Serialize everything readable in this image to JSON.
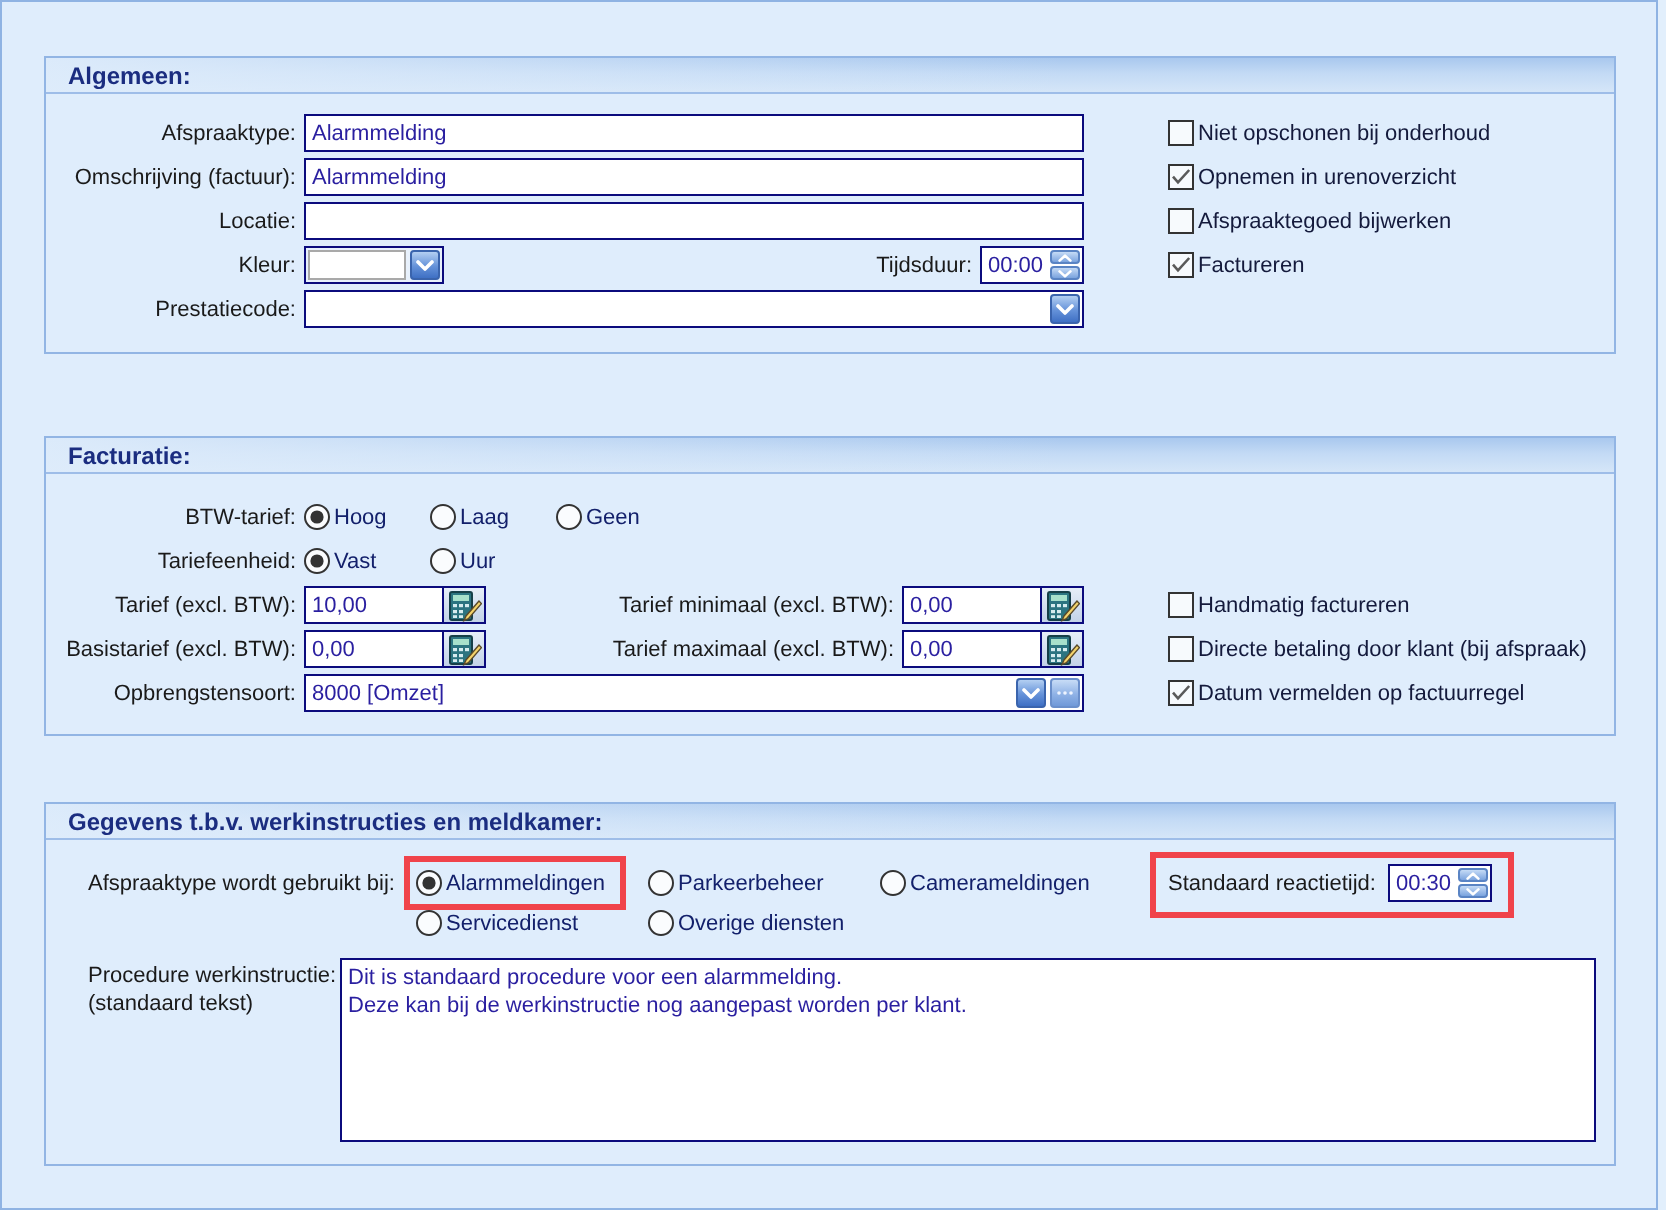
{
  "general": {
    "title": "Algemeen:",
    "fields": [
      {
        "label": "Afspraaktype:",
        "value": "Alarmmelding"
      },
      {
        "label": "Omschrijving (factuur):",
        "value": "Alarmmelding"
      },
      {
        "label": "Locatie:"
      }
    ],
    "color": {
      "label": "Kleur:"
    },
    "duration": {
      "label": "Tijdsduur:",
      "value": "00:00"
    },
    "performance_code": {
      "label": "Prestatiecode:"
    },
    "checkboxes": [
      {
        "label": "Niet opschonen bij onderhoud",
        "checked": false
      },
      {
        "label": "Opnemen in urenoverzicht",
        "checked": true
      },
      {
        "label": "Afspraaktegoed bijwerken",
        "checked": false
      },
      {
        "label": "Factureren",
        "checked": true
      }
    ]
  },
  "invoicing": {
    "title": "Facturatie:",
    "vat_rate": {
      "label": "BTW-tarief:",
      "options": [
        {
          "label": "Hoog",
          "selected": true
        },
        {
          "label": "Laag",
          "selected": false
        },
        {
          "label": "Geen",
          "selected": false
        }
      ]
    },
    "rate_unit": {
      "label": "Tariefeenheid:",
      "options": [
        {
          "label": "Vast",
          "selected": true
        },
        {
          "label": "Uur",
          "selected": false
        }
      ]
    },
    "rate": {
      "label": "Tarief (excl. BTW):",
      "value": "10,00"
    },
    "min_rate": {
      "label": "Tarief minimaal (excl. BTW):",
      "value": "0,00"
    },
    "base_rate": {
      "label": "Basistarief (excl. BTW):",
      "value": "0,00"
    },
    "max_rate": {
      "label": "Tarief maximaal (excl. BTW):",
      "value": "0,00"
    },
    "revenue_type": {
      "label": "Opbrengstensoort:",
      "value": "8000 [Omzet]"
    },
    "checkboxes": [
      {
        "label": "Handmatig factureren",
        "checked": false
      },
      {
        "label": "Directe betaling door klant (bij afspraak)",
        "checked": false
      },
      {
        "label": "Datum vermelden op factuurregel",
        "checked": true
      }
    ]
  },
  "instructions": {
    "title": "Gegevens t.b.v. werkinstructies en meldkamer:",
    "used_for": {
      "label": "Afspraaktype wordt gebruikt bij:",
      "options": [
        {
          "label": "Alarmmeldingen",
          "selected": true,
          "highlighted": true
        },
        {
          "label": "Parkeerbeheer",
          "selected": false,
          "highlighted": false
        },
        {
          "label": "Camerameldingen",
          "selected": false,
          "highlighted": false
        },
        {
          "label": "Servicedienst",
          "selected": false,
          "highlighted": false
        },
        {
          "label": "Overige diensten",
          "selected": false,
          "highlighted": false
        }
      ]
    },
    "response_time": {
      "label": "Standaard reactietijd:",
      "value": "00:30",
      "highlighted": true
    },
    "procedure": {
      "label": "Procedure werkinstructie:",
      "hint": "(standaard tekst)",
      "value": "Dit is standaard procedure voor een alarmmelding.\nDeze kan bij de werkinstructie nog aangepast worden per klant."
    }
  }
}
